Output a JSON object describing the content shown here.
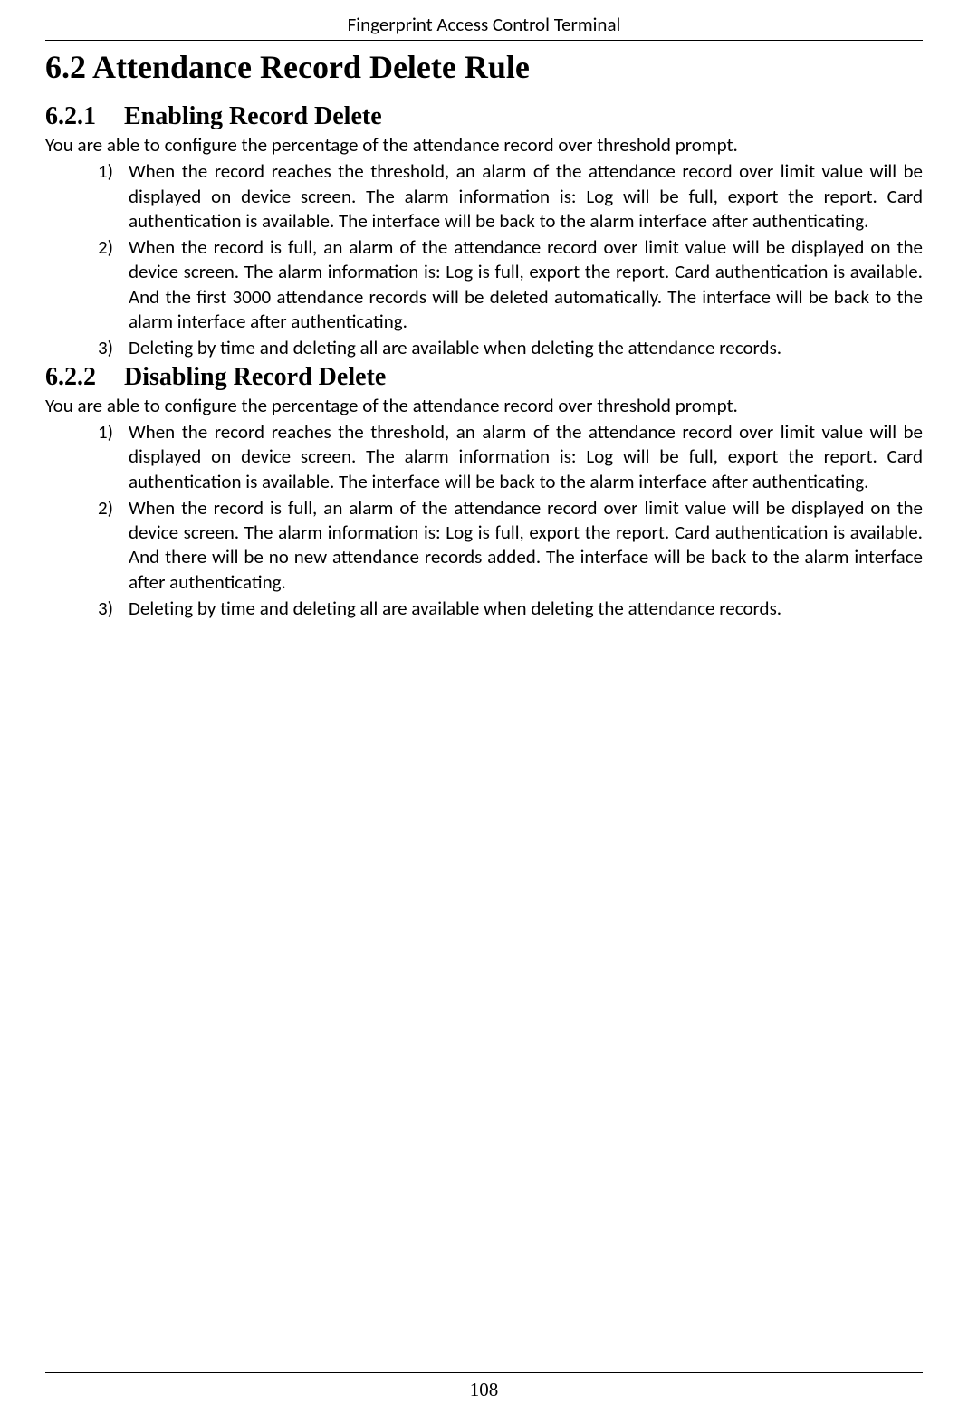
{
  "header": {
    "title": "Fingerprint Access Control Terminal"
  },
  "section": {
    "heading": "6.2 Attendance Record Delete Rule"
  },
  "subsection1": {
    "number": "6.2.1",
    "title": "Enabling Record Delete",
    "intro": "You are able to configure the percentage of the attendance record over threshold prompt.",
    "items": {
      "num1": "1)",
      "text1": "When the record reaches the threshold, an alarm of the attendance record over limit value will be displayed on device screen. The alarm information is: Log will be full, export the report. Card authentication is available. The interface will be back to the alarm interface after authenticating.",
      "num2": "2)",
      "text2": "When the record is full, an alarm of the attendance record over limit value will be displayed on the device screen. The alarm information is: Log is full, export the report. Card authentication is available. And the first 3000 attendance records will be deleted automatically. The interface will be back to the alarm interface after authenticating.",
      "num3": "3)",
      "text3": "Deleting by time and deleting all are available when deleting the attendance records."
    }
  },
  "subsection2": {
    "number": "6.2.2",
    "title": "Disabling Record Delete",
    "intro": "You are able to configure the percentage of the attendance record over threshold prompt.",
    "items": {
      "num1": "1)",
      "text1": "When the record reaches the threshold, an alarm of the attendance record over limit value will be displayed on device screen. The alarm information is: Log will be full, export the report. Card authentication is available. The interface will be back to the alarm interface after authenticating.",
      "num2": "2)",
      "text2": "When the record is full, an alarm of the attendance record over limit value will be displayed on the device screen. The alarm information is: Log is full, export the report. Card authentication is available. And there will be no new attendance records added. The interface will be back to the alarm interface after authenticating.",
      "num3": "3)",
      "text3": "Deleting by time and deleting all are available when deleting the attendance records."
    }
  },
  "footer": {
    "page_number": "108"
  }
}
